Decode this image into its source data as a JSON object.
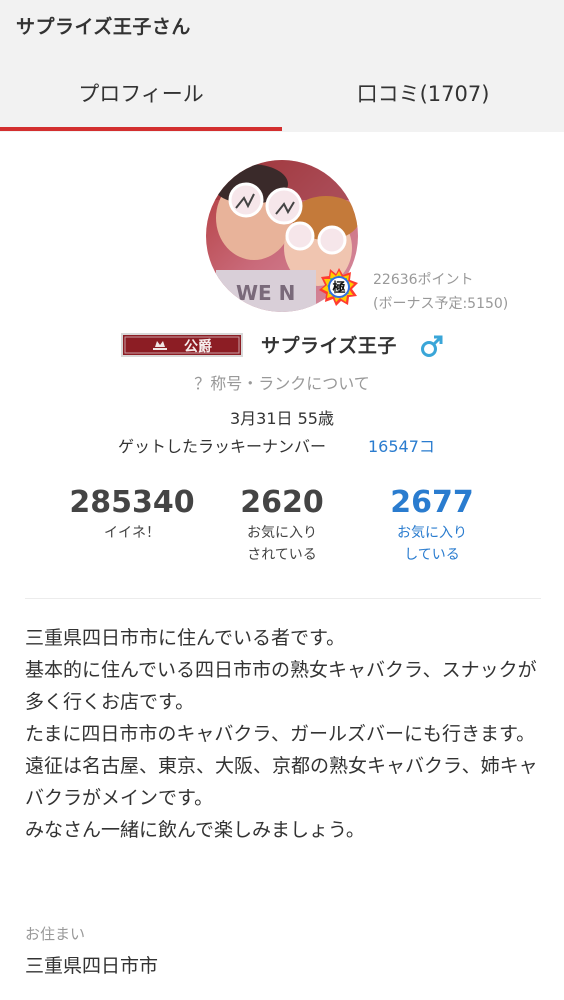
{
  "header": {
    "title": "サプライズ王子さん",
    "tabs": [
      {
        "label": "プロフィール",
        "active": true
      },
      {
        "label": "口コミ(1707)",
        "active": false
      }
    ],
    "accent_color": "#d32f2f"
  },
  "profile": {
    "rank_badge_text": "極",
    "points": "22636ポイント",
    "bonus": "(ボーナス予定:5150)",
    "title_plate_text": "公爵",
    "name": "サプライズ王子",
    "gender_icon": "male-icon",
    "rank_info_link": "？称号・ランクについて",
    "birthday": "3月31日 55歳",
    "lucky_label": "ゲットしたラッキーナンバー",
    "lucky_value": "16547コ"
  },
  "stats": [
    {
      "value": "285340",
      "label_lines": [
        "イイネ！"
      ]
    },
    {
      "value": "2620",
      "label_lines": [
        "お気に入り",
        "されている"
      ]
    },
    {
      "value": "2677",
      "label_lines": [
        "お気に入り",
        "している"
      ]
    }
  ],
  "bio": [
    "三重県四日市市に住んでいる者です。",
    "基本的に住んでいる四日市市の熟女キャバクラ、スナックが多く行くお店です。",
    "たまに四日市市のキャバクラ、ガールズバーにも行きます。",
    "遠征は名古屋、東京、大阪、京都の熟女キャバクラ、姉キャバクラがメインです。",
    "みなさん一緒に飲んで楽しみましょう。"
  ],
  "residence": {
    "label": "お住まい",
    "value": "三重県四日市市"
  },
  "colors": {
    "link_blue": "#2a7ccf",
    "muted_gray": "#999999",
    "plate_red": "#8c1d24"
  }
}
